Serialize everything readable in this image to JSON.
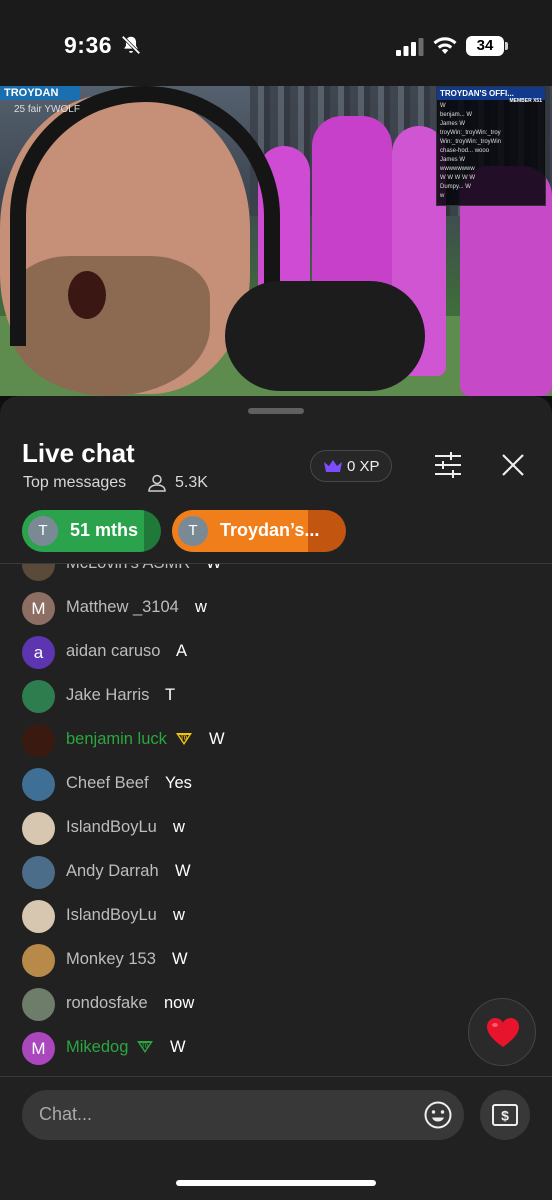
{
  "status_bar": {
    "time": "9:36",
    "battery": "34"
  },
  "video": {
    "overlay_brand": "TROYDAN",
    "overlay_stats": "25  fair   YWOLF",
    "stream_chat_title": "TROYDAN'S OFFI...",
    "stream_chat_badge": "MEMBER X51",
    "stream_chat_lines": [
      "W",
      "benjam... W",
      "James W",
      "troyWin:_troyWin:_troy",
      "Win:_troyWin:_troyWin",
      "chase-hod... wooo",
      "James W",
      "wwwwwwww",
      "W W W W W",
      "Dumpy... W",
      "w"
    ]
  },
  "chat": {
    "title": "Live chat",
    "filter": "Top messages",
    "viewers": "5.3K",
    "xp_label": "0 XP",
    "chips": [
      {
        "avatar_letter": "T",
        "label": "51 mths",
        "progress": 0.88
      },
      {
        "avatar_letter": "T",
        "label": "Troydan’s...",
        "progress": 0.78
      }
    ],
    "messages": [
      {
        "name": "McLovin's ASMR",
        "text": "W",
        "member": false,
        "badge": "",
        "avatar_letter": "",
        "avatar_color": "#5a4a3a"
      },
      {
        "name": "Matthew _3104",
        "text": "w",
        "member": false,
        "badge": "",
        "avatar_letter": "M",
        "avatar_color": "#8d6e63"
      },
      {
        "name": "aidan caruso",
        "text": "A",
        "member": false,
        "badge": "",
        "avatar_letter": "a",
        "avatar_color": "#5e35b1"
      },
      {
        "name": "Jake Harris",
        "text": "T",
        "member": false,
        "badge": "",
        "avatar_letter": "",
        "avatar_color": "#2e7d4f"
      },
      {
        "name": "benjamin luck",
        "text": "W",
        "member": true,
        "badge": "member-badge-gold",
        "avatar_letter": "",
        "avatar_color": "#3a1a10"
      },
      {
        "name": "Cheef Beef",
        "text": "Yes",
        "member": false,
        "badge": "",
        "avatar_letter": "",
        "avatar_color": "#3f6f95"
      },
      {
        "name": "IslandBoyLu",
        "text": "w",
        "member": false,
        "badge": "",
        "avatar_letter": "",
        "avatar_color": "#d7c7b0"
      },
      {
        "name": "Andy Darrah",
        "text": "W",
        "member": false,
        "badge": "",
        "avatar_letter": "",
        "avatar_color": "#4b6d8a"
      },
      {
        "name": "IslandBoyLu",
        "text": "w",
        "member": false,
        "badge": "",
        "avatar_letter": "",
        "avatar_color": "#d7c7b0"
      },
      {
        "name": "Monkey 153",
        "text": "W",
        "member": false,
        "badge": "",
        "avatar_letter": "",
        "avatar_color": "#b88a4a"
      },
      {
        "name": "rondosfake",
        "text": "now",
        "member": false,
        "badge": "",
        "avatar_letter": "",
        "avatar_color": "#6d7d6a"
      },
      {
        "name": "Mikedog",
        "text": "W",
        "member": true,
        "badge": "member-badge-green",
        "avatar_letter": "M",
        "avatar_color": "#ab47bc"
      }
    ],
    "input_placeholder": "Chat..."
  }
}
